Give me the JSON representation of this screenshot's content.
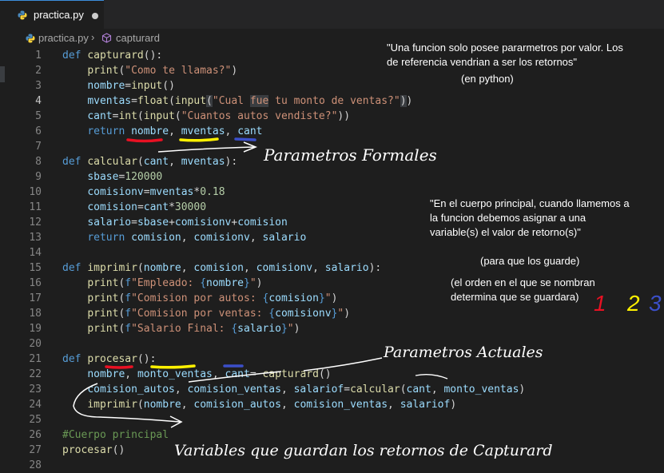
{
  "tab": {
    "filename": "practica.py"
  },
  "breadcrumb": {
    "file": "practica.py",
    "separator": "›",
    "function": "capturard"
  },
  "code_lines": [
    {
      "n": "1",
      "tokens": [
        [
          "kw",
          "def "
        ],
        [
          "fn",
          "capturard"
        ],
        [
          "tx",
          "():"
        ]
      ]
    },
    {
      "n": "2",
      "tokens": [
        [
          "tx",
          "    "
        ],
        [
          "fn",
          "print"
        ],
        [
          "tx",
          "("
        ],
        [
          "str",
          "\"Como te llamas?\""
        ],
        [
          "tx",
          ")"
        ]
      ]
    },
    {
      "n": "3",
      "tokens": [
        [
          "tx",
          "    "
        ],
        [
          "var",
          "nombre"
        ],
        [
          "tx",
          "="
        ],
        [
          "fn",
          "input"
        ],
        [
          "tx",
          "()"
        ]
      ]
    },
    {
      "n": "4",
      "tokens": [
        [
          "tx",
          "    "
        ],
        [
          "var",
          "mventas"
        ],
        [
          "tx",
          "="
        ],
        [
          "fn",
          "float"
        ],
        [
          "tx",
          "("
        ],
        [
          "fn",
          "input"
        ],
        [
          "hl",
          "("
        ],
        [
          "str",
          "\"Cual "
        ],
        [
          "hlstr",
          "fue"
        ],
        [
          "str",
          " tu monto de ventas?\""
        ],
        [
          "hl",
          ")"
        ],
        [
          "tx",
          ")"
        ]
      ]
    },
    {
      "n": "5",
      "tokens": [
        [
          "tx",
          "    "
        ],
        [
          "var",
          "cant"
        ],
        [
          "tx",
          "="
        ],
        [
          "fn",
          "int"
        ],
        [
          "tx",
          "("
        ],
        [
          "fn",
          "input"
        ],
        [
          "tx",
          "("
        ],
        [
          "str",
          "\"Cuantos autos vendiste?\""
        ],
        [
          "tx",
          "))"
        ]
      ]
    },
    {
      "n": "6",
      "tokens": [
        [
          "tx",
          "    "
        ],
        [
          "kw",
          "return "
        ],
        [
          "var",
          "nombre"
        ],
        [
          "tx",
          ", "
        ],
        [
          "var",
          "mventas"
        ],
        [
          "tx",
          ", "
        ],
        [
          "var",
          "cant"
        ]
      ]
    },
    {
      "n": "7",
      "tokens": []
    },
    {
      "n": "8",
      "tokens": [
        [
          "kw",
          "def "
        ],
        [
          "fn",
          "calcular"
        ],
        [
          "tx",
          "("
        ],
        [
          "var",
          "cant"
        ],
        [
          "tx",
          ", "
        ],
        [
          "var",
          "mventas"
        ],
        [
          "tx",
          "):"
        ]
      ]
    },
    {
      "n": "9",
      "tokens": [
        [
          "tx",
          "    "
        ],
        [
          "var",
          "sbase"
        ],
        [
          "tx",
          "="
        ],
        [
          "num",
          "120000"
        ]
      ]
    },
    {
      "n": "10",
      "tokens": [
        [
          "tx",
          "    "
        ],
        [
          "var",
          "comisionv"
        ],
        [
          "tx",
          "="
        ],
        [
          "var",
          "mventas"
        ],
        [
          "tx",
          "*"
        ],
        [
          "num",
          "0.18"
        ]
      ]
    },
    {
      "n": "11",
      "tokens": [
        [
          "tx",
          "    "
        ],
        [
          "var",
          "comision"
        ],
        [
          "tx",
          "="
        ],
        [
          "var",
          "cant"
        ],
        [
          "tx",
          "*"
        ],
        [
          "num",
          "30000"
        ]
      ]
    },
    {
      "n": "12",
      "tokens": [
        [
          "tx",
          "    "
        ],
        [
          "var",
          "salario"
        ],
        [
          "tx",
          "="
        ],
        [
          "var",
          "sbase"
        ],
        [
          "tx",
          "+"
        ],
        [
          "var",
          "comisionv"
        ],
        [
          "tx",
          "+"
        ],
        [
          "var",
          "comision"
        ]
      ]
    },
    {
      "n": "13",
      "tokens": [
        [
          "tx",
          "    "
        ],
        [
          "kw",
          "return "
        ],
        [
          "var",
          "comision"
        ],
        [
          "tx",
          ", "
        ],
        [
          "var",
          "comisionv"
        ],
        [
          "tx",
          ", "
        ],
        [
          "var",
          "salario"
        ]
      ]
    },
    {
      "n": "14",
      "tokens": []
    },
    {
      "n": "15",
      "tokens": [
        [
          "kw",
          "def "
        ],
        [
          "fn",
          "imprimir"
        ],
        [
          "tx",
          "("
        ],
        [
          "var",
          "nombre"
        ],
        [
          "tx",
          ", "
        ],
        [
          "var",
          "comision"
        ],
        [
          "tx",
          ", "
        ],
        [
          "var",
          "comisionv"
        ],
        [
          "tx",
          ", "
        ],
        [
          "var",
          "salario"
        ],
        [
          "tx",
          "):"
        ]
      ]
    },
    {
      "n": "16",
      "tokens": [
        [
          "tx",
          "    "
        ],
        [
          "fn",
          "print"
        ],
        [
          "tx",
          "("
        ],
        [
          "kw",
          "f"
        ],
        [
          "str",
          "\"Empleado: "
        ],
        [
          "kw",
          "{"
        ],
        [
          "var",
          "nombre"
        ],
        [
          "kw",
          "}"
        ],
        [
          "str",
          "\""
        ],
        [
          "tx",
          ")"
        ]
      ]
    },
    {
      "n": "17",
      "tokens": [
        [
          "tx",
          "    "
        ],
        [
          "fn",
          "print"
        ],
        [
          "tx",
          "("
        ],
        [
          "kw",
          "f"
        ],
        [
          "str",
          "\"Comision por autos: "
        ],
        [
          "kw",
          "{"
        ],
        [
          "var",
          "comision"
        ],
        [
          "kw",
          "}"
        ],
        [
          "str",
          "\""
        ],
        [
          "tx",
          ")"
        ]
      ]
    },
    {
      "n": "18",
      "tokens": [
        [
          "tx",
          "    "
        ],
        [
          "fn",
          "print"
        ],
        [
          "tx",
          "("
        ],
        [
          "kw",
          "f"
        ],
        [
          "str",
          "\"Comision por ventas: "
        ],
        [
          "kw",
          "{"
        ],
        [
          "var",
          "comisionv"
        ],
        [
          "kw",
          "}"
        ],
        [
          "str",
          "\""
        ],
        [
          "tx",
          ")"
        ]
      ]
    },
    {
      "n": "19",
      "tokens": [
        [
          "tx",
          "    "
        ],
        [
          "fn",
          "print"
        ],
        [
          "tx",
          "("
        ],
        [
          "kw",
          "f"
        ],
        [
          "str",
          "\"Salario Final: "
        ],
        [
          "kw",
          "{"
        ],
        [
          "var",
          "salario"
        ],
        [
          "kw",
          "}"
        ],
        [
          "str",
          "\""
        ],
        [
          "tx",
          ")"
        ]
      ]
    },
    {
      "n": "20",
      "tokens": []
    },
    {
      "n": "21",
      "tokens": [
        [
          "kw",
          "def "
        ],
        [
          "fn",
          "procesar"
        ],
        [
          "tx",
          "():"
        ]
      ]
    },
    {
      "n": "22",
      "tokens": [
        [
          "tx",
          "    "
        ],
        [
          "var",
          "nombre"
        ],
        [
          "tx",
          ", "
        ],
        [
          "var",
          "monto_ventas"
        ],
        [
          "tx",
          ", "
        ],
        [
          "var",
          "cant"
        ],
        [
          "tx",
          "= "
        ],
        [
          "fn",
          "capturard"
        ],
        [
          "tx",
          "()"
        ]
      ]
    },
    {
      "n": "23",
      "tokens": [
        [
          "tx",
          "    "
        ],
        [
          "var",
          "comision_autos"
        ],
        [
          "tx",
          ", "
        ],
        [
          "var",
          "comision_ventas"
        ],
        [
          "tx",
          ", "
        ],
        [
          "var",
          "salariof"
        ],
        [
          "tx",
          "="
        ],
        [
          "fn",
          "calcular"
        ],
        [
          "tx",
          "("
        ],
        [
          "var",
          "cant"
        ],
        [
          "tx",
          ", "
        ],
        [
          "var",
          "monto_ventas"
        ],
        [
          "tx",
          ")"
        ]
      ]
    },
    {
      "n": "24",
      "tokens": [
        [
          "tx",
          "    "
        ],
        [
          "fn",
          "imprimir"
        ],
        [
          "tx",
          "("
        ],
        [
          "var",
          "nombre"
        ],
        [
          "tx",
          ", "
        ],
        [
          "var",
          "comision_autos"
        ],
        [
          "tx",
          ", "
        ],
        [
          "var",
          "comision_ventas"
        ],
        [
          "tx",
          ", "
        ],
        [
          "var",
          "salariof"
        ],
        [
          "tx",
          ")"
        ]
      ]
    },
    {
      "n": "25",
      "tokens": []
    },
    {
      "n": "26",
      "tokens": [
        [
          "cm",
          "#Cuerpo principal"
        ]
      ]
    },
    {
      "n": "27",
      "tokens": [
        [
          "fn",
          "procesar"
        ],
        [
          "tx",
          "()"
        ]
      ]
    },
    {
      "n": "28",
      "tokens": []
    }
  ],
  "active_line": "4",
  "notes": {
    "top_line1": "\"Una funcion solo posee pararmetros por valor. Los",
    "top_line2": "de referencia vendrian a ser los retornos\"",
    "top_line3": "(en python)",
    "mid_line1": "\"En el cuerpo principal, cuando llamemos a",
    "mid_line2": "la funcion debemos asignar a una",
    "mid_line3": "variable(s) el valor de retorno(s)\"",
    "mid_line4": "(para que los guarde)",
    "mid_line5": "(el orden en el que se nombran",
    "mid_line6": "determina que se guardara)"
  },
  "handwriting": {
    "formales": "Parametros Formales",
    "actuales": "Parametros Actuales",
    "variables": "Variables que guardan los retornos de Capturard"
  },
  "order_numbers": {
    "one": "1",
    "two": "2",
    "three": "3"
  },
  "colors": {
    "red": "#e81123",
    "yellow": "#fff100",
    "blue": "#3b4fc9"
  }
}
